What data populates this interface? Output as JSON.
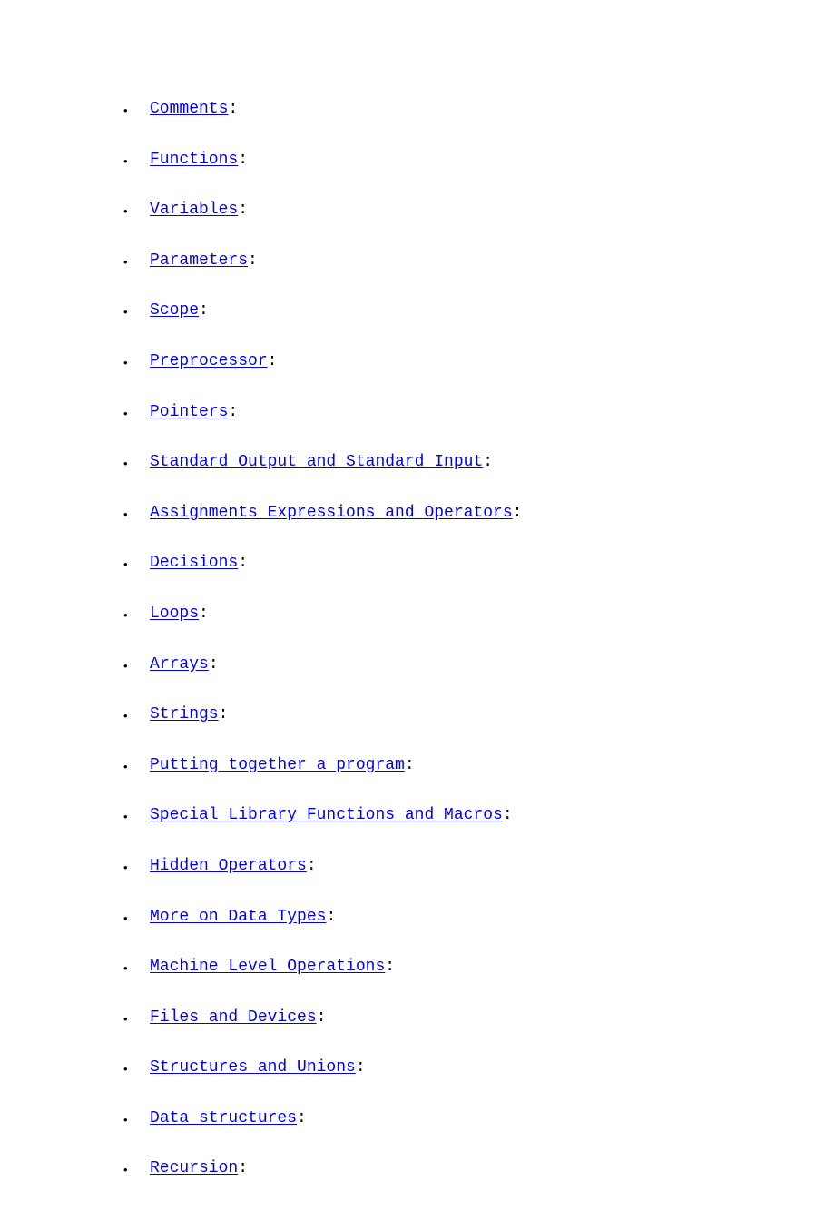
{
  "items": [
    {
      "label": "Comments"
    },
    {
      "label": "Functions"
    },
    {
      "label": "Variables"
    },
    {
      "label": "Parameters"
    },
    {
      "label": "Scope"
    },
    {
      "label": "Preprocessor"
    },
    {
      "label": "Pointers"
    },
    {
      "label": "Standard Output and Standard Input"
    },
    {
      "label": "Assignments Expressions and Operators"
    },
    {
      "label": "Decisions"
    },
    {
      "label": "Loops"
    },
    {
      "label": "Arrays"
    },
    {
      "label": "Strings"
    },
    {
      "label": "Putting together a program"
    },
    {
      "label": "Special Library Functions and Macros"
    },
    {
      "label": "Hidden Operators"
    },
    {
      "label": "More on Data Types"
    },
    {
      "label": "Machine Level Operations"
    },
    {
      "label": "Files and Devices"
    },
    {
      "label": "Structures and Unions"
    },
    {
      "label": "Data structures"
    },
    {
      "label": "Recursion"
    }
  ]
}
